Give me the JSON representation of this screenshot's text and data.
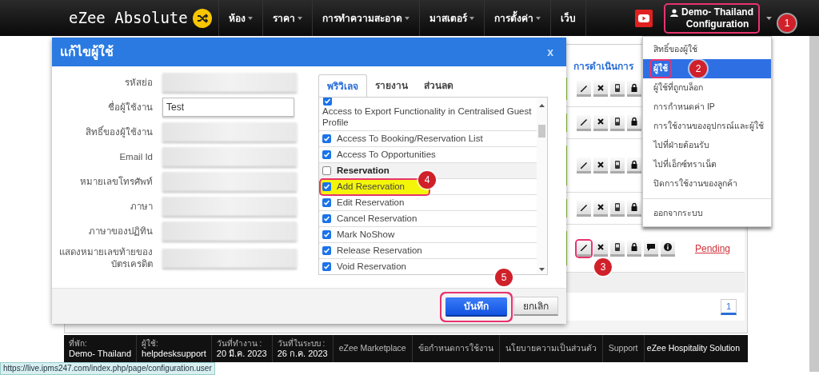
{
  "nav": {
    "logo": "eZee Absolute",
    "menu": [
      {
        "label": "ห้อง",
        "dropdown": true
      },
      {
        "label": "ราคา",
        "dropdown": true
      },
      {
        "label": "การทำความสะอาด",
        "dropdown": true
      },
      {
        "label": "มาสเตอร์",
        "dropdown": true
      },
      {
        "label": "การตั้งค่า",
        "dropdown": true
      },
      {
        "label": "เว็บ",
        "dropdown": false
      }
    ],
    "user": {
      "line1": "Demo- Thailand",
      "line2": "Configuration",
      "highlight": true,
      "callout": "1"
    }
  },
  "user_menu": {
    "items": [
      {
        "label": "สิทธิ์ของผู้ใช้",
        "selected": false
      },
      {
        "label": "ผู้ใช้",
        "selected": true,
        "highlight": true,
        "callout": "2"
      },
      {
        "label": "ผู้ใช้ที่ถูกบล็อก",
        "selected": false
      },
      {
        "label": "การกำหนดค่า IP",
        "selected": false
      },
      {
        "label": "การใช้งานของอุปกรณ์และผู้ใช้",
        "selected": false
      },
      {
        "label": "ไปที่ฝ่ายต้อนรับ",
        "selected": false
      },
      {
        "label": "ไปที่เอ็กซ์ทราเน็ต",
        "selected": false
      },
      {
        "label": "ปิดการใช้งานของลูกค้า",
        "selected": false
      }
    ],
    "logout": "ออกจากระบบ"
  },
  "users_table": {
    "column_header": "การดำเนินการ",
    "rows": [
      {
        "actions": [
          {
            "kind": "edit"
          },
          {
            "kind": "delete"
          },
          {
            "kind": "device"
          },
          {
            "kind": "lock"
          }
        ],
        "highlight": false
      },
      {
        "actions": [
          {
            "kind": "edit"
          },
          {
            "kind": "delete"
          },
          {
            "kind": "device"
          },
          {
            "kind": "lock"
          }
        ],
        "highlight": false
      },
      {
        "actions": [
          {
            "kind": "edit"
          },
          {
            "kind": "delete"
          },
          {
            "kind": "device"
          },
          {
            "kind": "lock"
          }
        ],
        "highlight": false
      },
      {
        "actions": [
          {
            "kind": "edit"
          },
          {
            "kind": "delete"
          },
          {
            "kind": "device"
          },
          {
            "kind": "lock"
          }
        ],
        "highlight": false
      },
      {
        "actions": [
          {
            "kind": "edit"
          },
          {
            "kind": "delete"
          },
          {
            "kind": "device"
          },
          {
            "kind": "lock"
          },
          {
            "kind": "comment"
          },
          {
            "kind": "info"
          }
        ],
        "status": "Pending",
        "highlight": true,
        "callout": "3"
      }
    ],
    "page": "1"
  },
  "dialog": {
    "title": "แก้ไขผู้ใช้",
    "close": "x",
    "fields": [
      {
        "label": "รหัสย่อ",
        "blurred": true
      },
      {
        "label": "ชื่อผู้ใช้งาน",
        "blurred": false,
        "value": "Test"
      },
      {
        "label": "สิทธิ์ของผู้ใช้งาน",
        "blurred": true
      },
      {
        "label": "Email Id",
        "blurred": true
      },
      {
        "label": "หมายเลขโทรศัพท์",
        "blurred": true
      },
      {
        "label": "ภาษา",
        "blurred": true
      },
      {
        "label": "ภาษาของปฏิทิน",
        "blurred": true
      },
      {
        "label": "แสดงหมายเลขท้ายของบัตรเครดิต",
        "blurred": true
      }
    ],
    "tabs": [
      {
        "label": "พริวิเลจ",
        "selected": true
      },
      {
        "label": "รายงาน",
        "selected": false
      },
      {
        "label": "ส่วนลด",
        "selected": false
      }
    ],
    "privileges": [
      {
        "kind": "wrapped",
        "label": "Access to Export Functionality in Centralised Guest Profile",
        "checked": true
      },
      {
        "kind": "item",
        "label": "Access To Booking/Reservation List",
        "checked": true
      },
      {
        "kind": "item",
        "label": "Access To Opportunities",
        "checked": true
      },
      {
        "kind": "group",
        "label": "Reservation",
        "checked": false
      },
      {
        "kind": "item",
        "label": "Add Reservation",
        "checked": true,
        "highlight": true,
        "callout": "4"
      },
      {
        "kind": "item",
        "label": "Edit Reservation",
        "checked": true
      },
      {
        "kind": "item",
        "label": "Cancel Reservation",
        "checked": true
      },
      {
        "kind": "item",
        "label": "Mark NoShow",
        "checked": true
      },
      {
        "kind": "item",
        "label": "Release Reservation",
        "checked": true
      },
      {
        "kind": "item",
        "label": "Void Reservation",
        "checked": true
      }
    ],
    "save": {
      "label": "บันทึก",
      "highlight": true,
      "callout": "5"
    },
    "cancel": "ยกเลิก"
  },
  "footer": {
    "cells": [
      {
        "label": "ที่พัก:",
        "value": "Demo- Thailand"
      },
      {
        "label": "ผู้ใช้:",
        "value": "helpdesksupport"
      },
      {
        "label": "วันที่ทำงาน :",
        "value": "20 มี.ค. 2023"
      },
      {
        "label": "วันที่ในระบบ :",
        "value": "26 ก.ค. 2023"
      }
    ],
    "links": [
      "eZee Marketplace",
      "ข้อกำหนดการใช้งาน",
      "นโยบายความเป็นส่วนตัว",
      "Support"
    ],
    "brand": "eZee Hospitality Solution"
  },
  "status_url": "https://live.ipms247.com/index.php/page/configuration.user"
}
